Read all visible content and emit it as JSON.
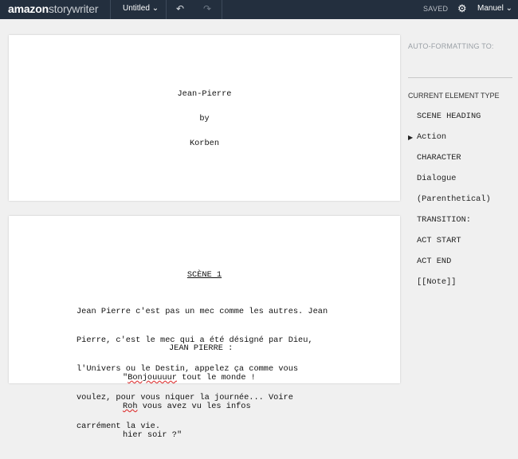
{
  "topbar": {
    "logo_bold": "amazon",
    "logo_light": "storywriter",
    "title": "Untitled",
    "title_caret": "⌄",
    "undo_icon": "↶",
    "redo_icon": "↷",
    "saved": "SAVED",
    "gear": "⚙",
    "user": "Manuel",
    "user_caret": "⌄"
  },
  "page1": {
    "title": "Jean-Pierre",
    "by": "by",
    "author": "Korben"
  },
  "page2": {
    "scene_heading": "SCÈNE 1",
    "action_lines": [
      "Jean Pierre c'est pas un mec comme les autres. Jean",
      "Pierre, c'est le mec qui a été désigné par Dieu,",
      "l'Univers ou le Destin, appelez ça comme vous",
      "voulez, pour vous niquer la journée... Voire",
      "carrément la vie."
    ],
    "character": "JEAN PIERRE :",
    "dialogue": {
      "l1_pre": "\"",
      "l1_err": "Bonjouuuur",
      "l1_post": " tout le monde !",
      "l2_err": "Roh",
      "l2_post": " vous avez vu les infos",
      "l3": "hier soir ?\""
    }
  },
  "panel": {
    "auto_label": "AUTO-FORMATTING TO:",
    "current_label": "CURRENT ELEMENT TYPE",
    "selected_marker": "▶",
    "elements": [
      "SCENE HEADING",
      "Action",
      "CHARACTER",
      "Dialogue",
      "(Parenthetical)",
      "TRANSITION:",
      "ACT START",
      "ACT END",
      "[[Note]]"
    ]
  }
}
